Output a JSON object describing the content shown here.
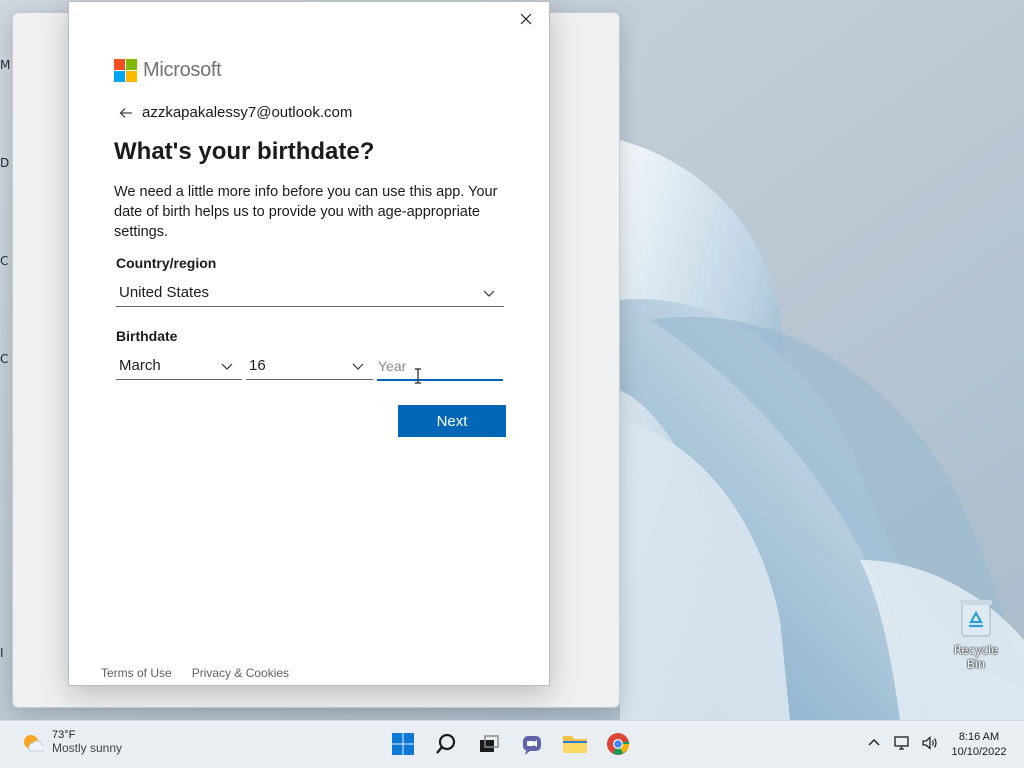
{
  "desktop": {
    "edge_labels": [
      "M",
      "D",
      "C",
      "C",
      "I"
    ],
    "recycle_bin_label": "Recycle Bin"
  },
  "dialog": {
    "brand": "Microsoft",
    "account_email": "azzkapakalessy7@outlook.com",
    "heading": "What's your birthdate?",
    "description": "We need a little more info before you can use this app. Your date of birth helps us to provide you with age-appropriate settings.",
    "country_label": "Country/region",
    "country_value": "United States",
    "birthdate_label": "Birthdate",
    "month_value": "March",
    "day_value": "16",
    "year_placeholder": "Year",
    "year_value": "",
    "next_label": "Next",
    "footer_links": [
      "Terms of Use",
      "Privacy & Cookies"
    ],
    "colors": {
      "accent": "#0067b8",
      "logo": [
        "#f25022",
        "#7fba00",
        "#00a4ef",
        "#ffb900"
      ]
    }
  },
  "taskbar": {
    "weather_temp": "73°F",
    "weather_condition": "Mostly sunny",
    "time": "8:16 AM",
    "date": "10/10/2022",
    "pinned": [
      "start-icon",
      "search-icon",
      "task-view-icon",
      "chat-icon",
      "file-explorer-icon",
      "chrome-icon"
    ]
  }
}
